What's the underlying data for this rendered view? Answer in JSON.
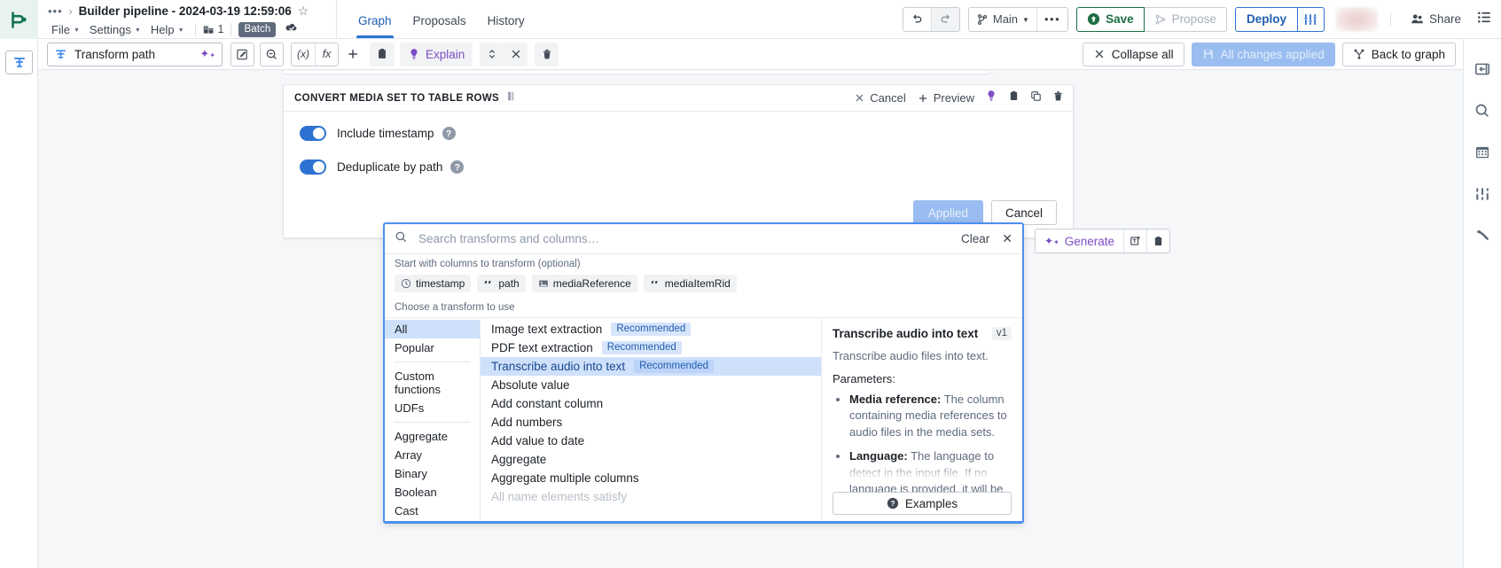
{
  "header": {
    "breadcrumb_dots": "•••",
    "breadcrumb_sep": "›",
    "doc_title": "Builder pipeline - 2024-03-19 12:59:06",
    "star_icon": "star-icon",
    "menus": [
      {
        "label": "File"
      },
      {
        "label": "Settings"
      },
      {
        "label": "Help"
      }
    ],
    "branch_count": "1",
    "mode_badge": "Batch",
    "tabs": [
      {
        "label": "Graph",
        "active": true
      },
      {
        "label": "Proposals",
        "active": false
      },
      {
        "label": "History",
        "active": false
      }
    ],
    "undo_icon": "undo-icon",
    "redo_icon": "redo-icon",
    "branch_label": "Main",
    "more_icon": "more-horizontal-icon",
    "save_label": "Save",
    "propose_label": "Propose",
    "deploy_label": "Deploy",
    "deploy_settings_icon": "sliders-icon",
    "share_label": "Share",
    "menu_icon": "list-menu-icon",
    "accent_blue": "#2d72d2",
    "save_green": "#1c6e42"
  },
  "toolbar": {
    "transform_path_label": "Transform path",
    "magic_icon": "sparkles-icon",
    "edit_icon": "edit-square-icon",
    "zoom_icon": "zoom-search-icon",
    "expr_icon": "(x)",
    "fx_icon": "fx",
    "plus_icon": "plus-icon",
    "clipboard_icon": "clipboard-icon",
    "explain_label": "Explain",
    "bulb_icon": "lightbulb-icon",
    "updown_icon": "chevron-up-down-icon",
    "collapse_x_icon": "close-x-icon",
    "trash_icon": "trash-icon",
    "collapse_all_label": "Collapse all",
    "all_changes_label": "All changes applied",
    "save_disk_icon": "floppy-disk-icon",
    "back_to_graph_label": "Back to graph",
    "back_graph_icon": "branch-graph-icon"
  },
  "right_rail": {
    "icons": [
      {
        "name": "panel-expand-icon"
      },
      {
        "name": "search-icon"
      },
      {
        "name": "calendar-icon"
      },
      {
        "name": "sliders-icon"
      },
      {
        "name": "hammer-icon"
      }
    ]
  },
  "card": {
    "title": "CONVERT MEDIA SET TO TABLE ROWS",
    "title_icon": "columns-icon",
    "actions": [
      {
        "name": "cancel",
        "label": "Cancel",
        "icon": "close-x-icon"
      },
      {
        "name": "preview",
        "label": "Preview",
        "icon": "plus-icon"
      }
    ],
    "icon_actions": [
      {
        "name": "lightbulb-icon"
      },
      {
        "name": "clipboard-icon"
      },
      {
        "name": "copy-icon"
      },
      {
        "name": "trash-icon"
      }
    ],
    "toggles": [
      {
        "label": "Include timestamp",
        "on": true,
        "help": "?"
      },
      {
        "label": "Deduplicate by path",
        "on": true,
        "help": "?"
      }
    ],
    "applied_label": "Applied",
    "cancel_label": "Cancel"
  },
  "popover": {
    "search_placeholder": "Search transforms and columns…",
    "search_value": "",
    "search_icon": "search-icon",
    "clear_label": "Clear",
    "close_label": "✕",
    "columns_hint": "Start with columns to transform (optional)",
    "columns": [
      {
        "label": "timestamp",
        "icon": "clock-icon"
      },
      {
        "label": "path",
        "icon": "quote-string-icon"
      },
      {
        "label": "mediaReference",
        "icon": "image-icon"
      },
      {
        "label": "mediaItemRid",
        "icon": "quote-string-icon"
      }
    ],
    "choose_hint": "Choose a transform to use",
    "categories": [
      {
        "label": "All",
        "selected": true
      },
      {
        "label": "Popular",
        "selected": false
      },
      {
        "divider": true
      },
      {
        "label": "Custom functions",
        "selected": false
      },
      {
        "label": "UDFs",
        "selected": false
      },
      {
        "divider": true
      },
      {
        "label": "Aggregate",
        "selected": false
      },
      {
        "label": "Array",
        "selected": false
      },
      {
        "label": "Binary",
        "selected": false
      },
      {
        "label": "Boolean",
        "selected": false
      },
      {
        "label": "Cast",
        "selected": false
      }
    ],
    "transforms": [
      {
        "label": "Image text extraction",
        "badge": "Recommended",
        "selected": false
      },
      {
        "label": "PDF text extraction",
        "badge": "Recommended",
        "selected": false
      },
      {
        "label": "Transcribe audio into text",
        "badge": "Recommended",
        "selected": true
      },
      {
        "label": "Absolute value",
        "badge": "",
        "selected": false
      },
      {
        "label": "Add constant column",
        "badge": "",
        "selected": false
      },
      {
        "label": "Add numbers",
        "badge": "",
        "selected": false
      },
      {
        "label": "Add value to date",
        "badge": "",
        "selected": false
      },
      {
        "label": "Aggregate",
        "badge": "",
        "selected": false
      },
      {
        "label": "Aggregate multiple columns",
        "badge": "",
        "selected": false
      },
      {
        "label": "All name elements satisfy",
        "badge": "",
        "selected": false,
        "clipped": true
      }
    ],
    "detail": {
      "title": "Transcribe audio into text",
      "version": "v1",
      "description": "Transcribe audio files into text.",
      "parameters_label": "Parameters:",
      "parameters": [
        {
          "name": "Media reference:",
          "desc": " The column containing media references to audio files in the media sets."
        },
        {
          "name": "Language:",
          "desc": " The language to detect in the input file. If no language is provided, it will be inferred from"
        }
      ],
      "examples_label": "Examples",
      "examples_icon": "help-circle-icon"
    }
  },
  "generate": {
    "label": "Generate",
    "magic_icon": "sparkles-icon",
    "new_col_icon": "new-text-column-icon",
    "clipboard_icon": "clipboard-icon"
  }
}
